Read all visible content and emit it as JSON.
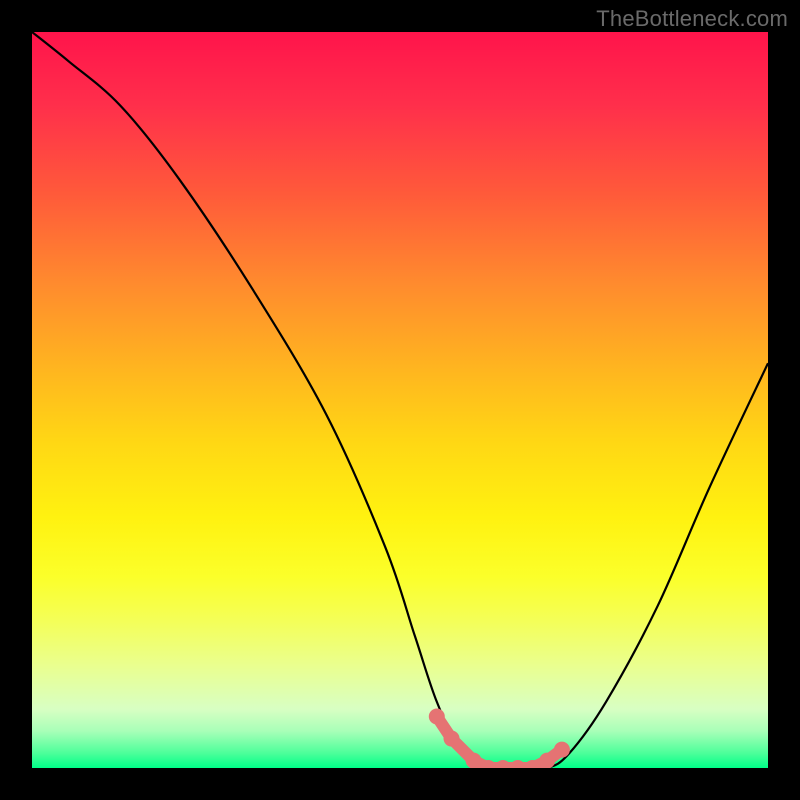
{
  "watermark": "TheBottleneck.com",
  "chart_data": {
    "type": "line",
    "title": "",
    "xlabel": "",
    "ylabel": "",
    "xlim": [
      0,
      100
    ],
    "ylim": [
      0,
      100
    ],
    "series": [
      {
        "name": "curve",
        "x": [
          0,
          5,
          12,
          20,
          30,
          40,
          48,
          52,
          55,
          58,
          62,
          66,
          70,
          73,
          78,
          85,
          92,
          100
        ],
        "y": [
          100,
          96,
          90,
          80,
          65,
          48,
          30,
          18,
          9,
          3,
          0,
          0,
          0,
          2,
          9,
          22,
          38,
          55
        ]
      }
    ],
    "markers": {
      "x": [
        55,
        57,
        60,
        62,
        64,
        66,
        68,
        70,
        72
      ],
      "y": [
        7,
        4,
        1,
        0,
        0,
        0,
        0,
        1,
        2.5
      ]
    },
    "colors": {
      "marker": "#e57373",
      "curve": "#000000"
    }
  }
}
